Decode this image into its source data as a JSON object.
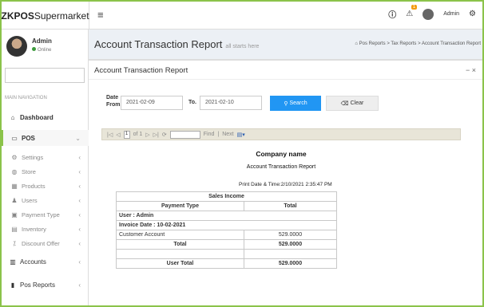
{
  "app": {
    "brand_bold": "ZKPOS",
    "brand_rest": "Supermarket",
    "menu_glyph": "≡",
    "user_name": "Admin"
  },
  "user_panel": {
    "name": "Admin",
    "status": "Online"
  },
  "sidebar": {
    "main_nav_label": "MAIN NAVIGATION",
    "items": [
      {
        "label": "Dashboard",
        "icon": "dashboard-icon",
        "glyph": "⌂"
      },
      {
        "label": "POS",
        "icon": "monitor-icon",
        "glyph": "▭"
      },
      {
        "label": "Settings",
        "icon": "gear-icon",
        "glyph": "⚙"
      },
      {
        "label": "Store",
        "icon": "store-icon",
        "glyph": "◍"
      },
      {
        "label": "Products",
        "icon": "products-icon",
        "glyph": "▦"
      },
      {
        "label": "Users",
        "icon": "users-icon",
        "glyph": "♟"
      },
      {
        "label": "Payment Type",
        "icon": "payment-icon",
        "glyph": "▣"
      },
      {
        "label": "Inventory",
        "icon": "inventory-icon",
        "glyph": "▤"
      },
      {
        "label": "Discount Offer",
        "icon": "discount-icon",
        "glyph": "⁒"
      },
      {
        "label": "Accounts",
        "icon": "accounts-icon",
        "glyph": "▥"
      },
      {
        "label": "Pos Reports",
        "icon": "reports-icon",
        "glyph": "▮"
      }
    ]
  },
  "header": {
    "title": "Account Transaction Report",
    "subtitle": "all starts here",
    "breadcrumb": [
      "Pos Reports",
      "Tax Reports",
      "Account Transaction Report"
    ]
  },
  "box": {
    "title": "Account Transaction Report",
    "tools": "− ×"
  },
  "filter": {
    "date_from_label": "Date From.",
    "date_from_value": "2021-02-09",
    "to_label": "To.",
    "to_value": "2021-02-10",
    "search_label": "Search",
    "clear_label": "Clear"
  },
  "toolbar": {
    "first": "|◁",
    "prev": "◁",
    "page": "1",
    "of": "of 1",
    "next": "▷",
    "last": "▷|",
    "refresh": "⟳",
    "find": "Find",
    "sep": "|",
    "next_text": "Next",
    "export": "▤▾"
  },
  "report": {
    "company": "Company name",
    "title": "Account Transaction Report",
    "print_datetime": "Print Date & Time:2/10/2021 2:35:47 PM",
    "section": "Sales Income",
    "col_payment": "Payment Type",
    "col_total": "Total",
    "user_line": "User : Admin",
    "invoice_line": "Invoice Date : 10-02-2021",
    "row_name": "Customer Account",
    "row_value": "529.0000",
    "subtotal_label": "Total",
    "subtotal_value": "529.0000",
    "user_total_label": "User Total",
    "user_total_value": "529.0000"
  },
  "colors": {
    "accent": "#8bc34a",
    "search_btn": "#2196f3",
    "badge": "#f39c12"
  }
}
